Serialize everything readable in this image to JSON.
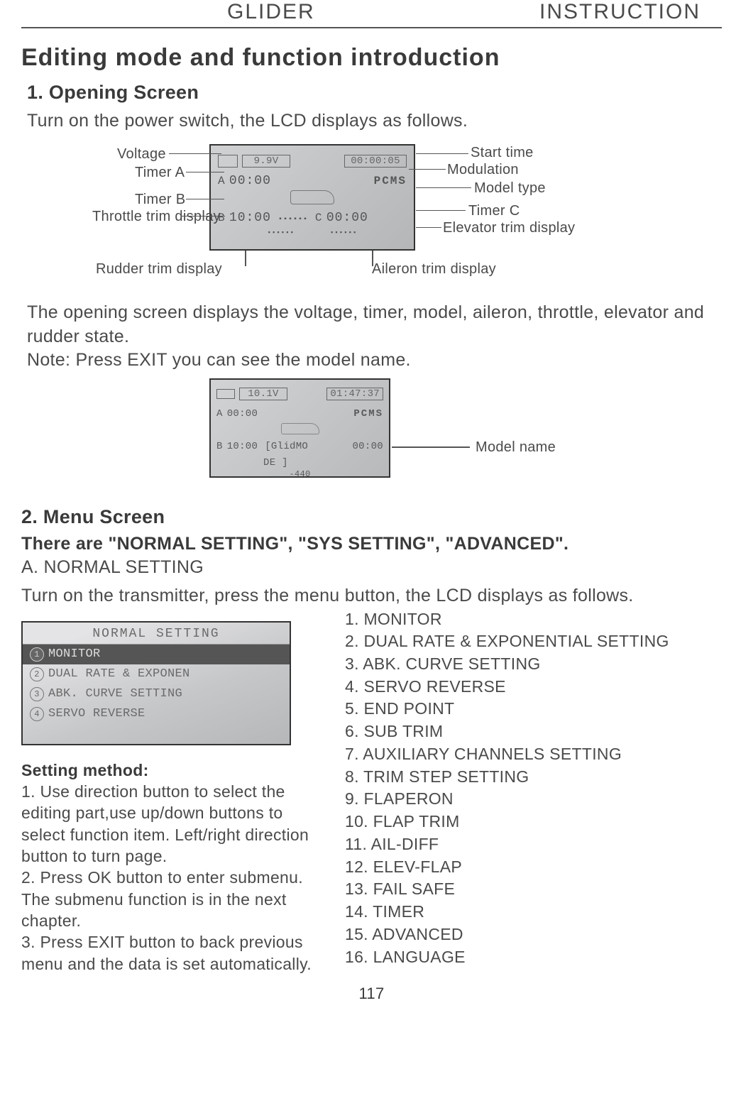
{
  "header": {
    "left": "GLIDER",
    "right": "INSTRUCTION"
  },
  "title": "Editing mode and function introduction",
  "sec1": {
    "heading": "1. Opening Screen",
    "intro": "Turn on the power switch, the LCD displays as follows.",
    "labels_left": {
      "voltage": "Voltage",
      "timerA": "Timer A",
      "timerB": "Timer B",
      "throttle": "Throttle trim display",
      "rudder": "Rudder trim display"
    },
    "labels_right": {
      "start": "Start time",
      "modulation": "Modulation",
      "modeltype": "Model type",
      "timerC": "Timer C",
      "elevator": "Elevator trim display",
      "aileron": "Aileron trim display"
    },
    "lcd": {
      "voltage": "9.9V",
      "start_time": "00:00:05",
      "timerA_lbl": "A",
      "timerA": "00:00",
      "modulation": "PCMS",
      "timerB_lbl": "B",
      "timerB": "10:00",
      "timerC_lbl": "C",
      "timerC": "00:00"
    },
    "para": "The opening screen displays the voltage, timer, model, aileron, throttle, elevator and rudder state.\nNote: Press EXIT you can see the model name.",
    "labelModelName": "Model name",
    "lcd2": {
      "voltage": "10.1V",
      "start_time": "01:47:37",
      "timerA_lbl": "A",
      "timerA": "00:00",
      "modulation": "PCMS",
      "timerB_lbl": "B",
      "timerB": "10:00",
      "modelname1": "[GlidMO",
      "modelname2": "DE   ]",
      "timerC": "00:00",
      "bottom": "-440"
    }
  },
  "sec2": {
    "heading": "2. Menu Screen",
    "line1": "There are \"NORMAL SETTING\", \"SYS SETTING\", \"ADVANCED\".",
    "line2": "A. NORMAL SETTING",
    "line3": "Turn on the transmitter,  press the menu button, the LCD displays as follows.",
    "lcd": {
      "title": "NORMAL SETTING",
      "rows": [
        {
          "n": "1",
          "t": "MONITOR",
          "sel": true
        },
        {
          "n": "2",
          "t": "DUAL RATE & EXPONEN",
          "sel": false
        },
        {
          "n": "3",
          "t": "ABK. CURVE SETTING",
          "sel": false
        },
        {
          "n": "4",
          "t": "SERVO REVERSE",
          "sel": false
        }
      ]
    },
    "menu": [
      "1. MONITOR",
      "2. DUAL RATE & EXPONENTIAL SETTING",
      "3. ABK. CURVE SETTING",
      "4. SERVO REVERSE",
      "5. END POINT",
      "6. SUB TRIM",
      "7. AUXILIARY CHANNELS SETTING",
      "8. TRIM STEP SETTING",
      "9. FLAPERON",
      "10. FLAP TRIM",
      "11. AIL-DIFF",
      "12. ELEV-FLAP",
      "13. FAIL SAFE",
      "14. TIMER",
      "15. ADVANCED",
      "16. LANGUAGE"
    ],
    "methodHeading": "Setting method:",
    "method": "1. Use direction button to select the editing part,use up/down buttons to select function item. Left/right direction button to turn page.\n2. Press OK button to enter submenu. The submenu function is in the next chapter.\n3. Press EXIT button to back previous menu and the data is set automatically."
  },
  "pagenum": "117"
}
